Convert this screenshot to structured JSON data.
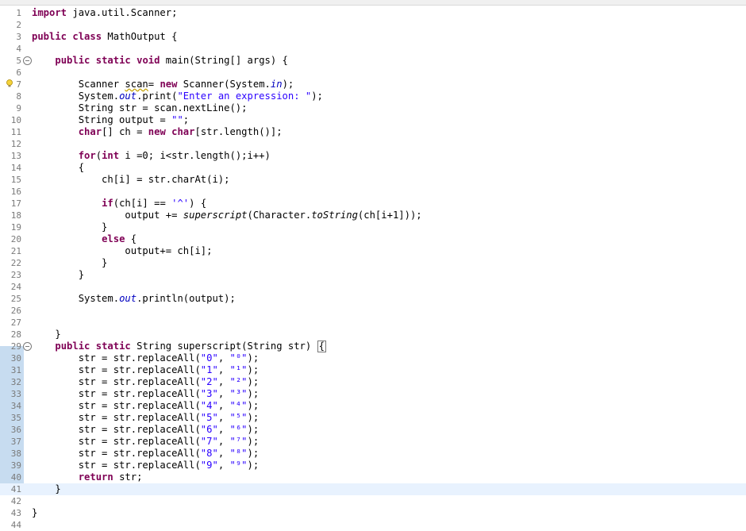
{
  "editor": {
    "lines": [
      {
        "n": "1",
        "segs": [
          {
            "t": "import",
            "c": "kw"
          },
          {
            "t": " java.util.Scanner;"
          }
        ]
      },
      {
        "n": "2",
        "segs": []
      },
      {
        "n": "3",
        "segs": [
          {
            "t": "public",
            "c": "kw"
          },
          {
            "t": " "
          },
          {
            "t": "class",
            "c": "kw"
          },
          {
            "t": " MathOutput {"
          }
        ]
      },
      {
        "n": "4",
        "segs": []
      },
      {
        "n": "5",
        "fold": true,
        "segs": [
          {
            "t": "    "
          },
          {
            "t": "public",
            "c": "kw"
          },
          {
            "t": " "
          },
          {
            "t": "static",
            "c": "kw"
          },
          {
            "t": " "
          },
          {
            "t": "void",
            "c": "kw"
          },
          {
            "t": " main(String[] args) {"
          }
        ]
      },
      {
        "n": "6",
        "segs": []
      },
      {
        "n": "7",
        "warn": true,
        "segs": [
          {
            "t": "        Scanner "
          },
          {
            "t": "scan",
            "c": "squiggle"
          },
          {
            "t": "= "
          },
          {
            "t": "new",
            "c": "kw"
          },
          {
            "t": " Scanner(System."
          },
          {
            "t": "in",
            "c": "fld"
          },
          {
            "t": ");"
          }
        ]
      },
      {
        "n": "8",
        "segs": [
          {
            "t": "        System."
          },
          {
            "t": "out",
            "c": "fld"
          },
          {
            "t": ".print("
          },
          {
            "t": "\"Enter an expression: \"",
            "c": "str"
          },
          {
            "t": ");"
          }
        ]
      },
      {
        "n": "9",
        "segs": [
          {
            "t": "        String str = scan.nextLine();"
          }
        ]
      },
      {
        "n": "10",
        "segs": [
          {
            "t": "        String output = "
          },
          {
            "t": "\"\"",
            "c": "str"
          },
          {
            "t": ";"
          }
        ]
      },
      {
        "n": "11",
        "segs": [
          {
            "t": "        "
          },
          {
            "t": "char",
            "c": "kw"
          },
          {
            "t": "[] ch = "
          },
          {
            "t": "new",
            "c": "kw"
          },
          {
            "t": " "
          },
          {
            "t": "char",
            "c": "kw"
          },
          {
            "t": "[str.length()];"
          }
        ]
      },
      {
        "n": "12",
        "segs": []
      },
      {
        "n": "13",
        "segs": [
          {
            "t": "        "
          },
          {
            "t": "for",
            "c": "kw"
          },
          {
            "t": "("
          },
          {
            "t": "int",
            "c": "kw"
          },
          {
            "t": " i =0; i<str.length();i++)"
          }
        ]
      },
      {
        "n": "14",
        "segs": [
          {
            "t": "        {"
          }
        ]
      },
      {
        "n": "15",
        "segs": [
          {
            "t": "            ch[i] = str.charAt(i);"
          }
        ]
      },
      {
        "n": "16",
        "segs": []
      },
      {
        "n": "17",
        "segs": [
          {
            "t": "            "
          },
          {
            "t": "if",
            "c": "kw"
          },
          {
            "t": "(ch[i] == "
          },
          {
            "t": "'^'",
            "c": "str"
          },
          {
            "t": ") {"
          }
        ]
      },
      {
        "n": "18",
        "segs": [
          {
            "t": "                output += "
          },
          {
            "t": "superscript",
            "c": "ital"
          },
          {
            "t": "(Character."
          },
          {
            "t": "toString",
            "c": "ital"
          },
          {
            "t": "(ch[i+1]));"
          }
        ]
      },
      {
        "n": "19",
        "segs": [
          {
            "t": "            }"
          }
        ]
      },
      {
        "n": "20",
        "segs": [
          {
            "t": "            "
          },
          {
            "t": "else",
            "c": "kw"
          },
          {
            "t": " {"
          }
        ]
      },
      {
        "n": "21",
        "segs": [
          {
            "t": "                output+= ch[i];"
          }
        ]
      },
      {
        "n": "22",
        "segs": [
          {
            "t": "            }"
          }
        ]
      },
      {
        "n": "23",
        "segs": [
          {
            "t": "        }"
          }
        ]
      },
      {
        "n": "24",
        "segs": []
      },
      {
        "n": "25",
        "segs": [
          {
            "t": "        System."
          },
          {
            "t": "out",
            "c": "fld"
          },
          {
            "t": ".println(output);"
          }
        ]
      },
      {
        "n": "26",
        "segs": []
      },
      {
        "n": "27",
        "segs": []
      },
      {
        "n": "28",
        "segs": [
          {
            "t": "    }"
          }
        ]
      },
      {
        "n": "29",
        "fold": true,
        "segs": [
          {
            "t": "    "
          },
          {
            "t": "public",
            "c": "kw"
          },
          {
            "t": " "
          },
          {
            "t": "static",
            "c": "kw"
          },
          {
            "t": " String superscript(String str) "
          },
          {
            "t": "{",
            "c": "caret-brace"
          }
        ]
      },
      {
        "n": "30",
        "segs": [
          {
            "t": "        str = str.replaceAll("
          },
          {
            "t": "\"0\"",
            "c": "str"
          },
          {
            "t": ", "
          },
          {
            "t": "\"⁰\"",
            "c": "str"
          },
          {
            "t": ");"
          }
        ]
      },
      {
        "n": "31",
        "segs": [
          {
            "t": "        str = str.replaceAll("
          },
          {
            "t": "\"1\"",
            "c": "str"
          },
          {
            "t": ", "
          },
          {
            "t": "\"¹\"",
            "c": "str"
          },
          {
            "t": ");"
          }
        ]
      },
      {
        "n": "32",
        "segs": [
          {
            "t": "        str = str.replaceAll("
          },
          {
            "t": "\"2\"",
            "c": "str"
          },
          {
            "t": ", "
          },
          {
            "t": "\"²\"",
            "c": "str"
          },
          {
            "t": ");"
          }
        ]
      },
      {
        "n": "33",
        "segs": [
          {
            "t": "        str = str.replaceAll("
          },
          {
            "t": "\"3\"",
            "c": "str"
          },
          {
            "t": ", "
          },
          {
            "t": "\"³\"",
            "c": "str"
          },
          {
            "t": ");"
          }
        ]
      },
      {
        "n": "34",
        "segs": [
          {
            "t": "        str = str.replaceAll("
          },
          {
            "t": "\"4\"",
            "c": "str"
          },
          {
            "t": ", "
          },
          {
            "t": "\"⁴\"",
            "c": "str"
          },
          {
            "t": ");"
          }
        ]
      },
      {
        "n": "35",
        "segs": [
          {
            "t": "        str = str.replaceAll("
          },
          {
            "t": "\"5\"",
            "c": "str"
          },
          {
            "t": ", "
          },
          {
            "t": "\"⁵\"",
            "c": "str"
          },
          {
            "t": ");"
          }
        ]
      },
      {
        "n": "36",
        "segs": [
          {
            "t": "        str = str.replaceAll("
          },
          {
            "t": "\"6\"",
            "c": "str"
          },
          {
            "t": ", "
          },
          {
            "t": "\"⁶\"",
            "c": "str"
          },
          {
            "t": ");"
          }
        ]
      },
      {
        "n": "37",
        "segs": [
          {
            "t": "        str = str.replaceAll("
          },
          {
            "t": "\"7\"",
            "c": "str"
          },
          {
            "t": ", "
          },
          {
            "t": "\"⁷\"",
            "c": "str"
          },
          {
            "t": ");"
          }
        ]
      },
      {
        "n": "38",
        "segs": [
          {
            "t": "        str = str.replaceAll("
          },
          {
            "t": "\"8\"",
            "c": "str"
          },
          {
            "t": ", "
          },
          {
            "t": "\"⁸\"",
            "c": "str"
          },
          {
            "t": ");"
          }
        ]
      },
      {
        "n": "39",
        "segs": [
          {
            "t": "        str = str.replaceAll("
          },
          {
            "t": "\"9\"",
            "c": "str"
          },
          {
            "t": ", "
          },
          {
            "t": "\"⁹\"",
            "c": "str"
          },
          {
            "t": ");"
          }
        ]
      },
      {
        "n": "40",
        "segs": [
          {
            "t": "        "
          },
          {
            "t": "return",
            "c": "kw"
          },
          {
            "t": " str;"
          }
        ]
      },
      {
        "n": "41",
        "current": true,
        "segs": [
          {
            "t": "    }"
          }
        ]
      },
      {
        "n": "42",
        "segs": []
      },
      {
        "n": "43",
        "segs": [
          {
            "t": "}"
          }
        ]
      },
      {
        "n": "44",
        "segs": []
      }
    ]
  },
  "icons": {
    "warning": "warning-lightbulb-icon",
    "fold": "fold-minus-icon"
  },
  "colors": {
    "keyword": "#7f0055",
    "string": "#2a00ff",
    "field": "#0000c0",
    "current_line": "#e8f2fe",
    "gutter_highlight": "#c7dcf0"
  }
}
